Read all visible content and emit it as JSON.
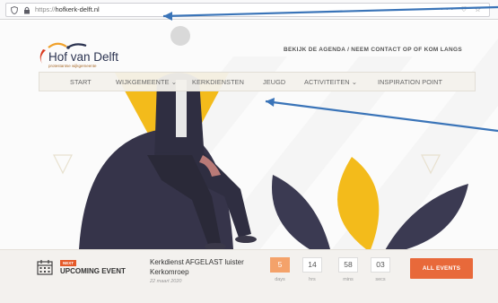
{
  "browser": {
    "url_prefix": "https://",
    "url_domain": "hofkerk-delft.nl",
    "toolbar_icons": "··· ♡ ☆"
  },
  "site": {
    "logo_name": "Hof van Delft",
    "logo_tagline": "protestantse wijkgemeente",
    "top_links": "BEKIJK DE AGENDA  /  NEEM CONTACT OP OF KOM LANGS",
    "nav": [
      {
        "label": "START"
      },
      {
        "label": "WIJKGEMEENTE ⌄"
      },
      {
        "label": "KERKDIENSTEN"
      },
      {
        "label": "JEUGD"
      },
      {
        "label": "ACTIVITEITEN ⌄"
      },
      {
        "label": "INSPIRATION POINT"
      }
    ]
  },
  "event": {
    "badge": "NEXT",
    "label": "UPCOMING EVENT",
    "title": "Kerkdienst AFGELAST luister Kerkomroep",
    "date": "22 maart 2020",
    "countdown": [
      {
        "value": "5",
        "unit": "days"
      },
      {
        "value": "14",
        "unit": "hrs"
      },
      {
        "value": "58",
        "unit": "mins"
      },
      {
        "value": "03",
        "unit": "secs"
      }
    ],
    "button": "ALL EVENTS"
  },
  "colors": {
    "accent_orange": "#e8693a",
    "hero_yellow": "#f3bb1b",
    "navy": "#2f2e41",
    "arrow_blue": "#3a74b8"
  },
  "icons": [
    "shield-icon",
    "lock-icon",
    "calendar-icon"
  ]
}
